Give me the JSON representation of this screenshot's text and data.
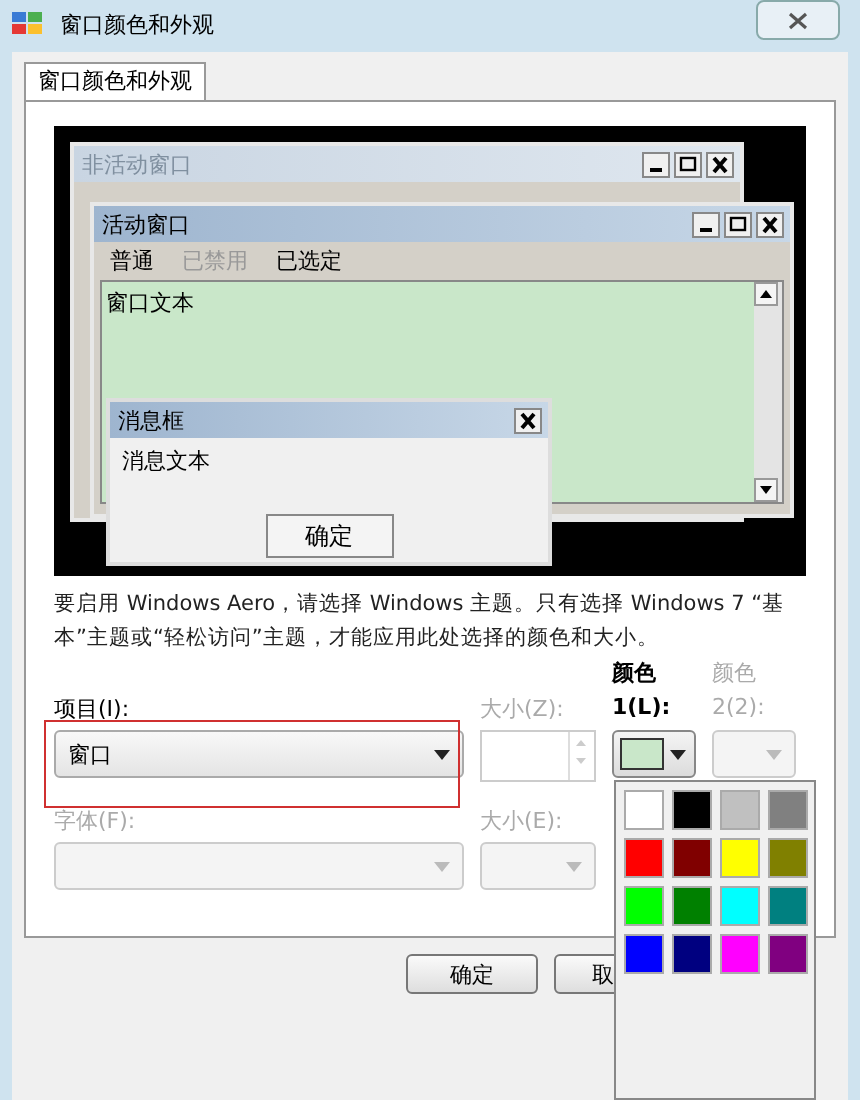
{
  "window": {
    "title": "窗口颜色和外观"
  },
  "tabs": [
    {
      "label": "窗口颜色和外观",
      "selected": true
    }
  ],
  "preview": {
    "inactive_window": {
      "title": "非活动窗口"
    },
    "active_window": {
      "title": "活动窗口",
      "menu": [
        {
          "label": "普通",
          "disabled": false
        },
        {
          "label": "已禁用",
          "disabled": true
        },
        {
          "label": "已选定",
          "disabled": false
        }
      ],
      "text": "窗口文本"
    },
    "message_box": {
      "title": "消息框",
      "text": "消息文本",
      "button": "确定"
    }
  },
  "notice": "要启用 Windows Aero，请选择 Windows 主题。只有选择 Windows 7 “基本”主题或“轻松访问”主题，才能应用此处选择的颜色和大小。",
  "item": {
    "label": "项目(I):",
    "value": "窗口",
    "highlighted": true
  },
  "item_size": {
    "label": "大小(Z):",
    "disabled": true
  },
  "color1": {
    "label": "颜色 1(L):",
    "disabled": false,
    "color": "#c9e7c9"
  },
  "color2": {
    "label": "颜色 2(2):",
    "disabled": true
  },
  "font": {
    "label": "字体(F):",
    "disabled": true
  },
  "font_size": {
    "label": "大小(E):",
    "disabled": true
  },
  "palette": [
    {
      "color": "#ffffff"
    },
    {
      "color": "#000000"
    },
    {
      "color": "#c0c0c0"
    },
    {
      "color": "#808080"
    },
    {
      "color": "#ff0000"
    },
    {
      "color": "#800000"
    },
    {
      "color": "#ffff00"
    },
    {
      "color": "#808000"
    },
    {
      "color": "#00ff00"
    },
    {
      "color": "#008000"
    },
    {
      "color": "#00ffff"
    },
    {
      "color": "#008080"
    },
    {
      "color": "#0000ff"
    },
    {
      "color": "#000080"
    },
    {
      "color": "#ff00ff"
    },
    {
      "color": "#800080"
    }
  ],
  "buttons": [
    {
      "label": "确定"
    },
    {
      "label": "取"
    }
  ]
}
